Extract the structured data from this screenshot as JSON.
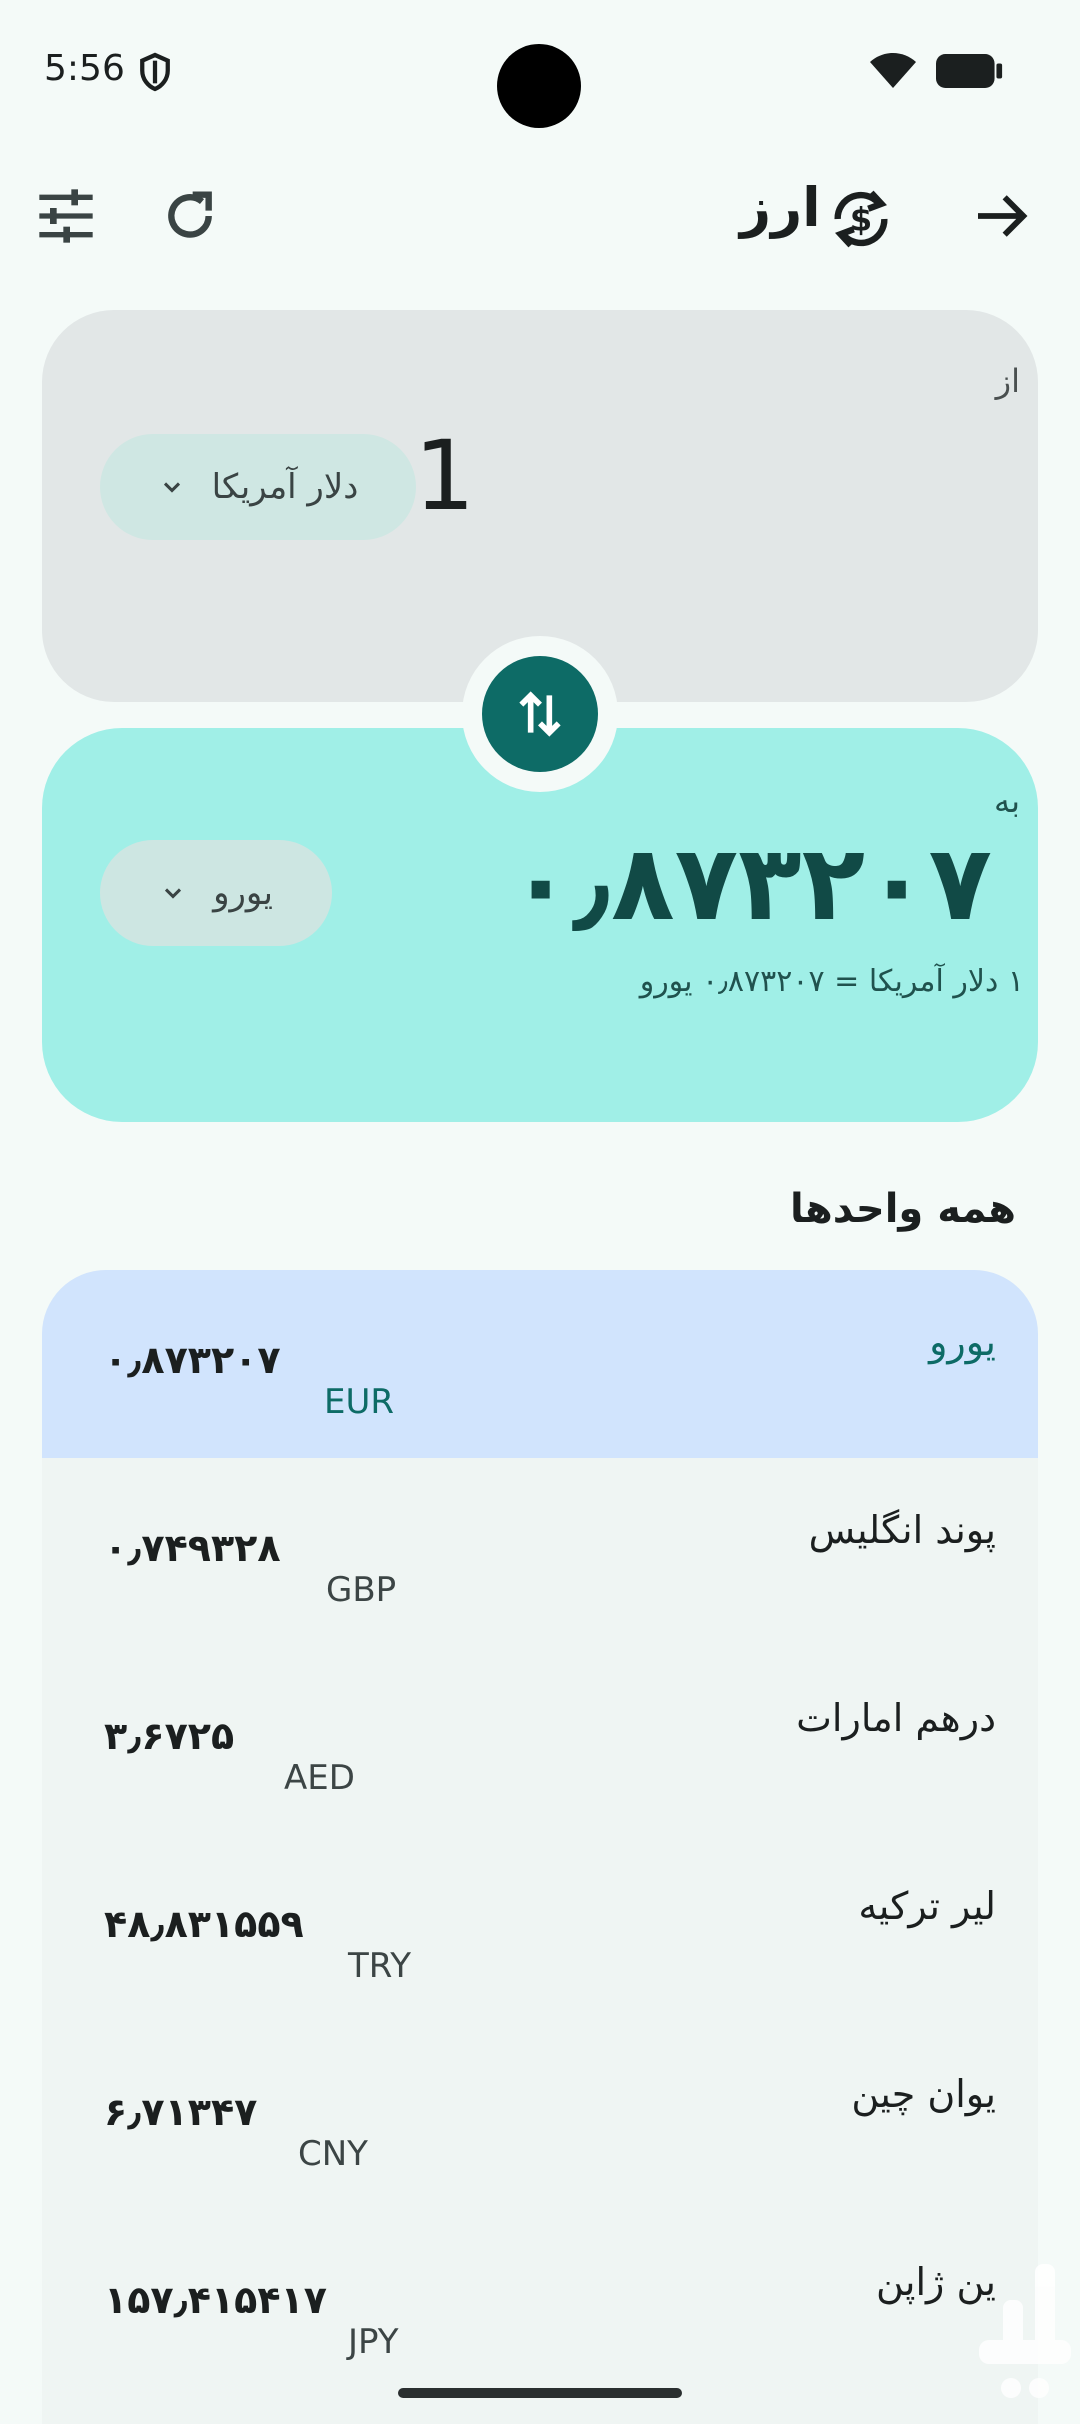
{
  "status_bar": {
    "time": "5:56"
  },
  "top_bar": {
    "title": "ارز"
  },
  "from": {
    "label": "از",
    "amount": "1",
    "currency": "دلار آمریکا"
  },
  "to": {
    "label": "به",
    "amount": "۰٫۸۷۳۲۰۷",
    "currency": "یورو",
    "rate_text": "۱ دلار آمریکا = ۰٫۸۷۳۲۰۷ یورو"
  },
  "all_units": {
    "title": "همه واحدها",
    "items": [
      {
        "name": "یورو",
        "code": "EUR",
        "value": "۰٫۸۷۳۲۰۷",
        "selected": true
      },
      {
        "name": "پوند انگلیس",
        "code": "GBP",
        "value": "۰٫۷۴۹۳۲۸"
      },
      {
        "name": "درهم امارات",
        "code": "AED",
        "value": "۳٫۶۷۲۵"
      },
      {
        "name": "لیر ترکیه",
        "code": "TRY",
        "value": "۴۸٫۸۳۱۵۵۹"
      },
      {
        "name": "یوان چین",
        "code": "CNY",
        "value": "۶٫۷۱۳۴۷"
      },
      {
        "name": "ین ژاپن",
        "code": "JPY",
        "value": "۱۵۷٫۴۱۵۴۱۷"
      }
    ]
  },
  "colors": {
    "accent": "#0d6b66",
    "to_card": "#a0efe7",
    "selected_row": "#d1e4fd"
  }
}
